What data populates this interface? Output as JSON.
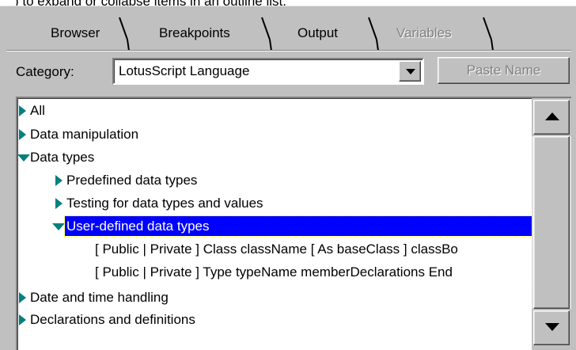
{
  "caption": ") to expand or collapse items in an outline list.",
  "tabs": [
    {
      "label": "Browser",
      "enabled": true
    },
    {
      "label": "Breakpoints",
      "enabled": true
    },
    {
      "label": "Output",
      "enabled": true
    },
    {
      "label": "Variables",
      "enabled": false
    }
  ],
  "category": {
    "label": "Category:",
    "value": "LotusScript Language"
  },
  "paste_button": {
    "label": "Paste Name",
    "enabled": false
  },
  "outline": {
    "items": [
      {
        "label": "All",
        "level": 0,
        "state": "collapsed"
      },
      {
        "label": "Data manipulation",
        "level": 0,
        "state": "collapsed"
      },
      {
        "label": "Data types",
        "level": 0,
        "state": "expanded"
      },
      {
        "label": "Predefined data types",
        "level": 1,
        "state": "collapsed"
      },
      {
        "label": "Testing for data types and values",
        "level": 1,
        "state": "collapsed"
      },
      {
        "label": "User-defined data types",
        "level": 1,
        "state": "expanded",
        "selected": true
      },
      {
        "label": "[ Public | Private ] Class className [ As baseClass ] classBo",
        "level": 2,
        "state": "leaf"
      },
      {
        "label": "[ Public | Private ] Type typeName memberDeclarations End",
        "level": 2,
        "state": "leaf"
      },
      {
        "label": "Date and time handling",
        "level": 0,
        "state": "collapsed"
      },
      {
        "label": "Declarations and definitions",
        "level": 0,
        "state": "collapsed"
      }
    ]
  },
  "colors": {
    "panel": "#c0c0c0",
    "selection": "#0000ff",
    "triangle": "#00807f"
  }
}
